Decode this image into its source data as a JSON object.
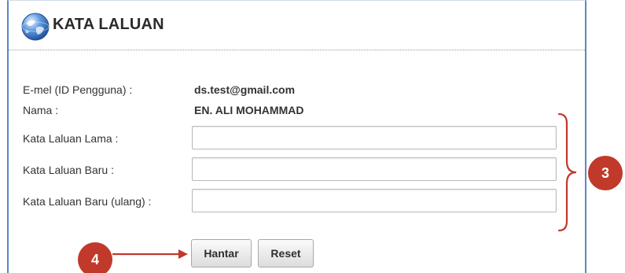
{
  "header": {
    "title": "KATA LALUAN",
    "icon": "globe-icon"
  },
  "info": {
    "email_label": "E-mel (ID Pengguna) :",
    "email_value": "ds.test@gmail.com",
    "name_label": "Nama :",
    "name_value": "EN. ALI MOHAMMAD"
  },
  "form": {
    "old_password_label": "Kata Laluan Lama :",
    "old_password_value": "",
    "new_password_label": "Kata Laluan Baru :",
    "new_password_value": "",
    "repeat_password_label": "Kata Laluan Baru (ulang) :",
    "repeat_password_value": ""
  },
  "buttons": {
    "submit_label": "Hantar",
    "reset_label": "Reset"
  },
  "annotations": {
    "callout_inputs": "3",
    "callout_buttons": "4"
  },
  "colors": {
    "panel_border": "#5b88c2",
    "callout": "#c0392b"
  }
}
